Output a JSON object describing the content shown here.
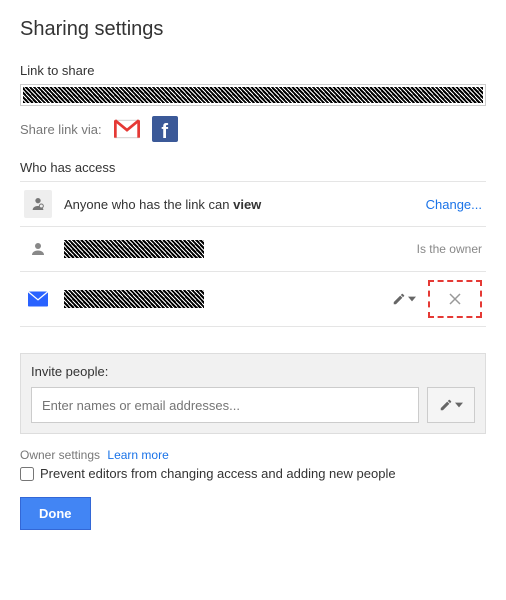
{
  "title": "Sharing settings",
  "link_section": {
    "label": "Link to share",
    "value_redacted": true
  },
  "share_via": {
    "label": "Share link via:",
    "gmail": "gmail-icon",
    "facebook": "facebook-icon"
  },
  "access": {
    "label": "Who has access",
    "rows": [
      {
        "icon": "link-person",
        "text_prefix": "Anyone who has the link can ",
        "text_bold": "view",
        "action": "Change..."
      },
      {
        "icon": "person",
        "name_redacted": true,
        "status": "Is the owner"
      },
      {
        "icon": "envelope",
        "name_redacted": true,
        "perm_icon": "pencil",
        "remove_icon": "x",
        "remove_highlighted": true
      }
    ]
  },
  "invite": {
    "label": "Invite people:",
    "placeholder": "Enter names or email addresses...",
    "perm_icon": "pencil"
  },
  "owner_settings": {
    "label": "Owner settings",
    "learn_more": "Learn more",
    "checkbox_label": "Prevent editors from changing access and adding new people"
  },
  "done": "Done"
}
